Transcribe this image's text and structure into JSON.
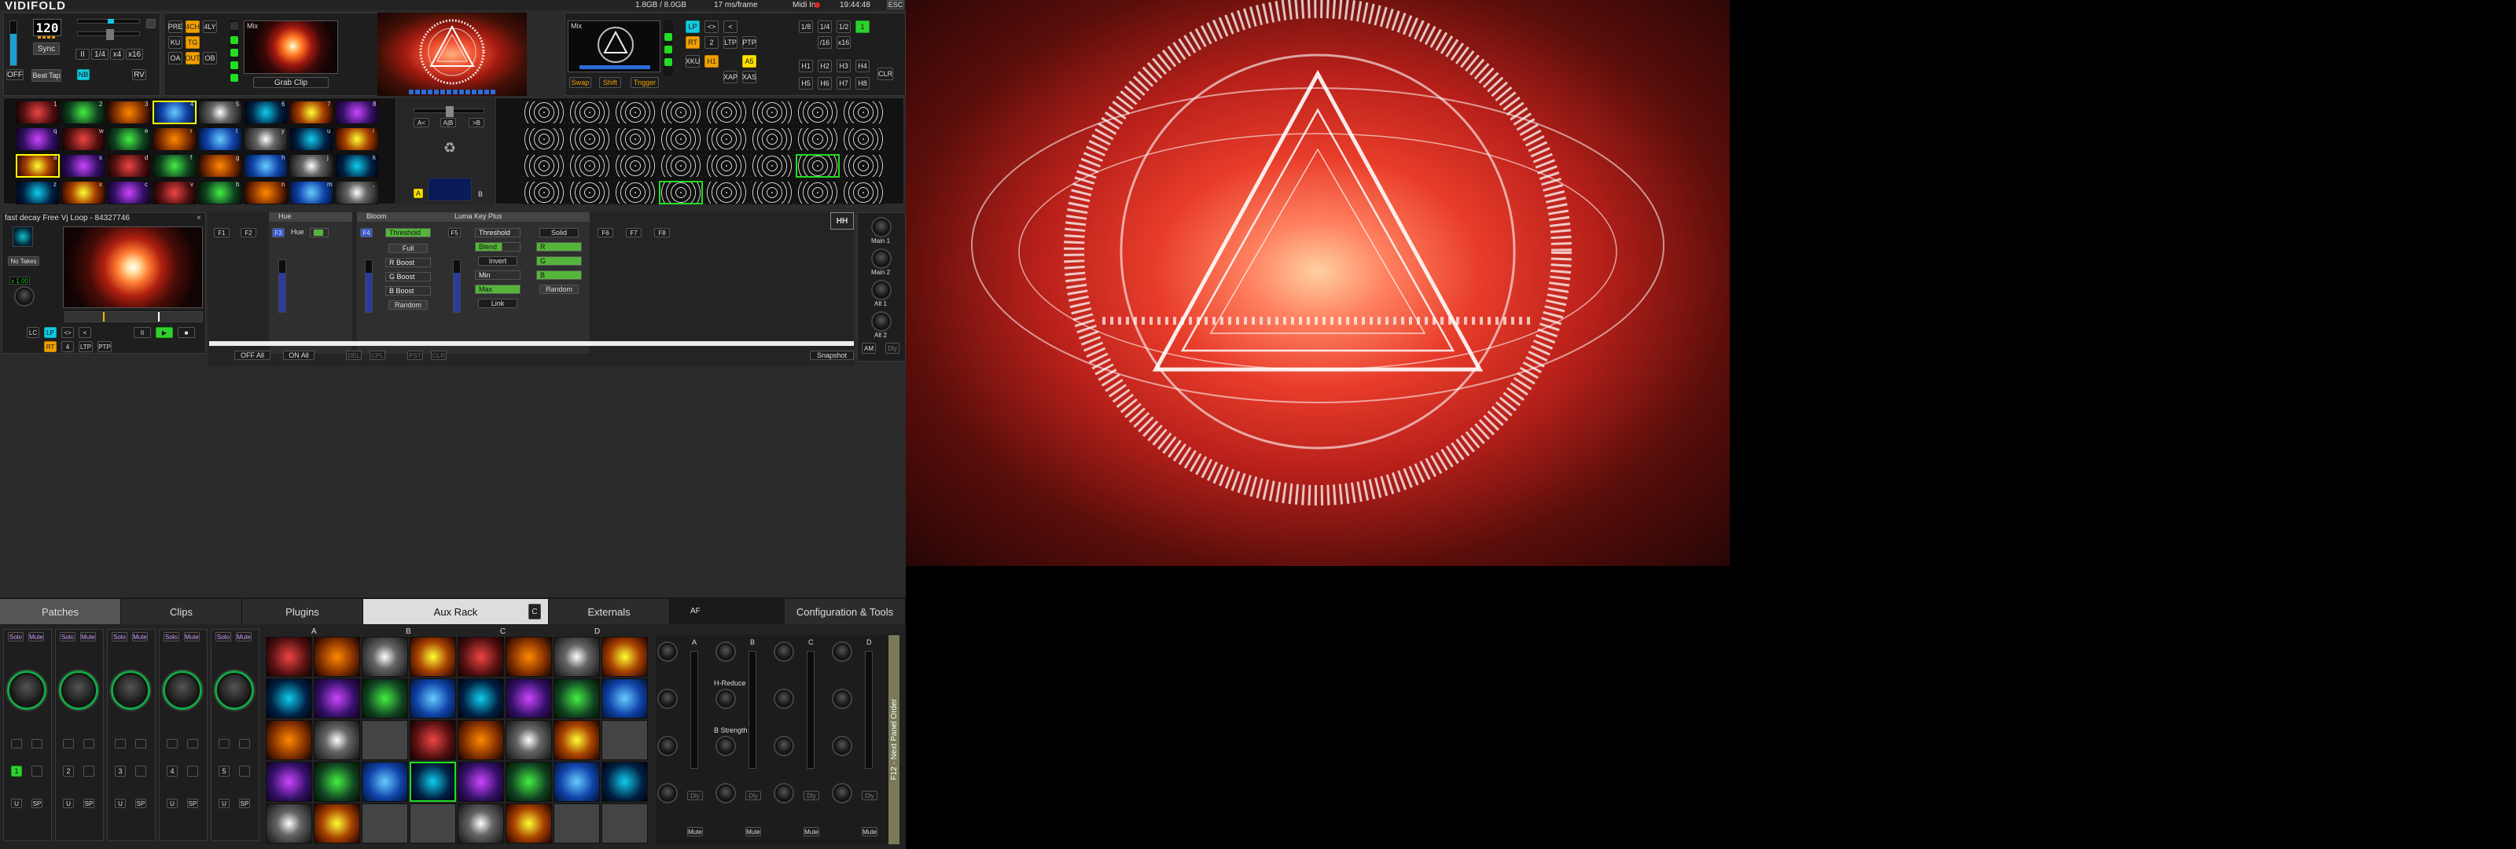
{
  "app": {
    "title": "VIDIFOLD",
    "memory": "1.8GB / 8.0GB",
    "frametime": "17 ms/frame",
    "midi": "Midi In",
    "clock": "19:44:48",
    "esc": "ESC"
  },
  "transport": {
    "bpm": "120",
    "off": "OFF",
    "sync": "Sync",
    "beat_tap": "Beat Tap",
    "nb": "NB",
    "rv": "RV",
    "div": [
      "II",
      "1/4",
      "x4",
      "x16"
    ]
  },
  "mix_left": {
    "modes": [
      "PRE",
      "4CH",
      "4LY",
      "KU",
      "TG",
      "OA",
      "OUT",
      "OB"
    ],
    "preview_title": "Mix",
    "grab": "Grab Clip"
  },
  "mix_right": {
    "preview_title": "Mix",
    "swap": "Swap",
    "shift": "Shift",
    "trigger": "Trigger",
    "buttons": [
      "LP",
      "<>",
      "<",
      "RT",
      "2",
      "LTP",
      "PTP",
      "XKU",
      "H1",
      "A5",
      "XAP",
      "XAS"
    ]
  },
  "rates": {
    "row1": [
      "1/8",
      "1/4",
      "1/2",
      "1"
    ],
    "row2": [
      "/16",
      "x16"
    ],
    "hot": [
      "H1",
      "H2",
      "H3",
      "H4",
      "H5",
      "H6",
      "H7",
      "H8"
    ],
    "clr": "CLR"
  },
  "crossfader": {
    "a": "A<",
    "ab": "A|B",
    ">b": ">B",
    "a_label": "A",
    "b_label": "B"
  },
  "grid_left": {
    "num_labels": [
      "1",
      "2",
      "3",
      "4",
      "5",
      "6",
      "7",
      "8"
    ],
    "row_labels": [
      [
        "q",
        "w",
        "e",
        "r",
        "t",
        "y",
        "u",
        "i"
      ],
      [
        "a",
        "s",
        "d",
        "f",
        "g",
        "h",
        "j",
        "k"
      ],
      [
        "z",
        "x",
        "c",
        "v",
        "b",
        "n",
        "m",
        ","
      ]
    ]
  },
  "clip": {
    "title": "fast decay Free Vj Loop - 84327746",
    "no_takes": "No Takes",
    "speed": "x 1.00",
    "lc": "LC",
    "lp": "LP",
    "fw": "<>",
    "bw": "<",
    "rt": "RT",
    "n4": "4",
    "ltp": "LTP",
    "ptp": "PTP"
  },
  "effects": {
    "slots": [
      "F1",
      "F2",
      "F3",
      "F4",
      "F5",
      "F6",
      "F7",
      "F8"
    ],
    "hue": {
      "title": "Hue",
      "param": "Hue"
    },
    "bloom": {
      "title": "Bloom",
      "params": [
        "Threshold",
        "Full",
        "R Boost",
        "G Boost",
        "B Boost",
        "Random"
      ]
    },
    "luma": {
      "title": "Luma Key Plus",
      "left": [
        "Threshold",
        "Blend",
        "Invert",
        "Min",
        "Max",
        "Link"
      ],
      "right": [
        "Solid",
        "R",
        "G",
        "B",
        "Random"
      ]
    },
    "off_all": "OFF All",
    "on_all": "ON All",
    "btns": [
      "DEL",
      "CPL",
      "PST",
      "CLR"
    ],
    "snapshot": "Snapshot"
  },
  "masters": {
    "labels": [
      "Main 1",
      "Main 2",
      "Alt 1",
      "Alt 2"
    ],
    "am": "AM",
    "dly": "Dly"
  },
  "tabs": [
    "Patches",
    "Clips",
    "Plugins",
    "Aux Rack",
    "Externals",
    "AF",
    "Configuration & Tools"
  ],
  "tab_c": "C",
  "strips": [
    {
      "n": "1"
    },
    {
      "n": "2"
    },
    {
      "n": "3"
    },
    {
      "n": "4"
    },
    {
      "n": "5"
    }
  ],
  "strip_labels": {
    "solo": "Solo",
    "mute": "Mute",
    "u": "U",
    "sp": "SP"
  },
  "bank_labels": [
    "A",
    "B",
    "C",
    "D"
  ],
  "aux": {
    "h_reduce": "H-Reduce",
    "b_strength": "B Strength",
    "dly": "Dly",
    "mute": "Mute",
    "letters": [
      "A",
      "B",
      "C",
      "D"
    ],
    "side": "F12 - Next Panel Order"
  }
}
